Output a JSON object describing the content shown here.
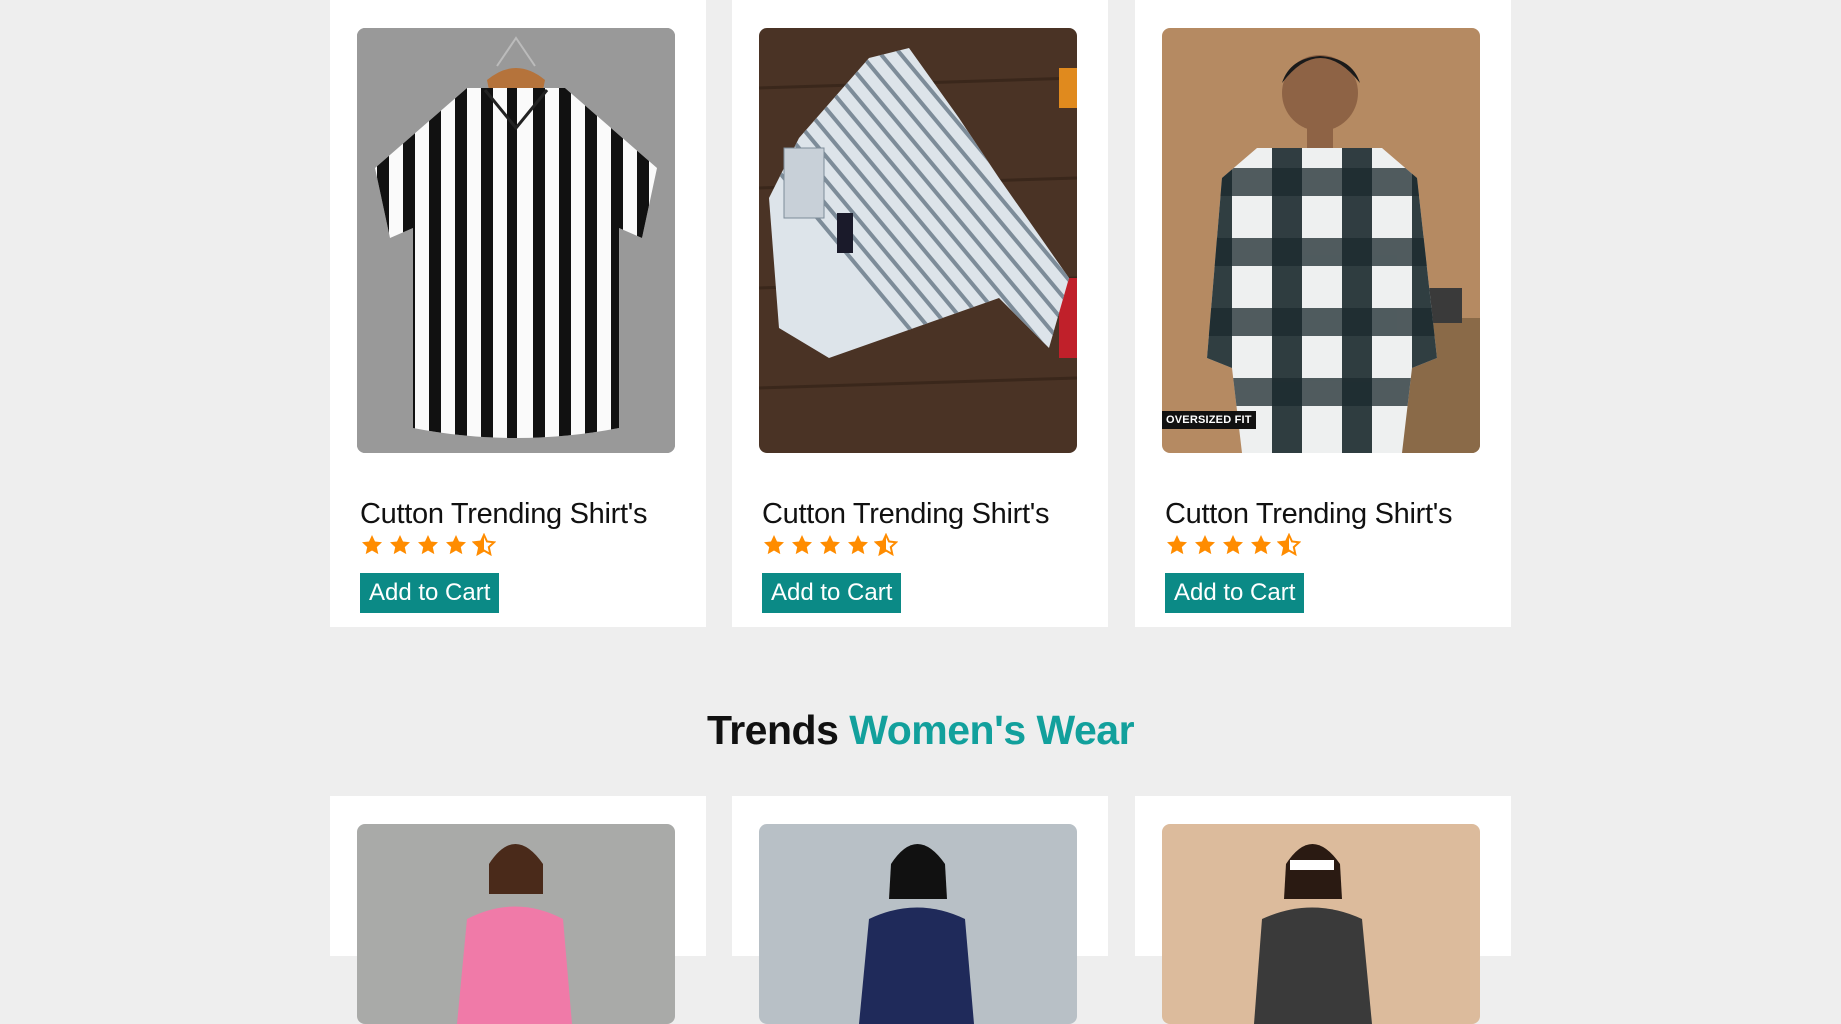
{
  "products": [
    {
      "title": "Cutton Trending Shirt's",
      "rating": 4.5,
      "button": "Add to Cart",
      "image": "striped-black-white-shirt"
    },
    {
      "title": "Cutton Trending Shirt's",
      "rating": 4.5,
      "button": "Add to Cart",
      "image": "folded-striped-shirt"
    },
    {
      "title": "Cutton Trending Shirt's",
      "rating": 4.5,
      "button": "Add to Cart",
      "image": "checked-oversized-shirt",
      "badge": "OVERSIZED FIT"
    }
  ],
  "section": {
    "title_main": "Trends",
    "title_accent": "Women's Wear"
  },
  "women_products": [
    {
      "image": "pink-top-model"
    },
    {
      "image": "navy-dotted-top-model"
    },
    {
      "image": "printed-top-model"
    }
  ],
  "colors": {
    "accent": "#12a09c",
    "button": "#0b8a86",
    "star": "#ff8c00",
    "background": "#eeeeee"
  }
}
